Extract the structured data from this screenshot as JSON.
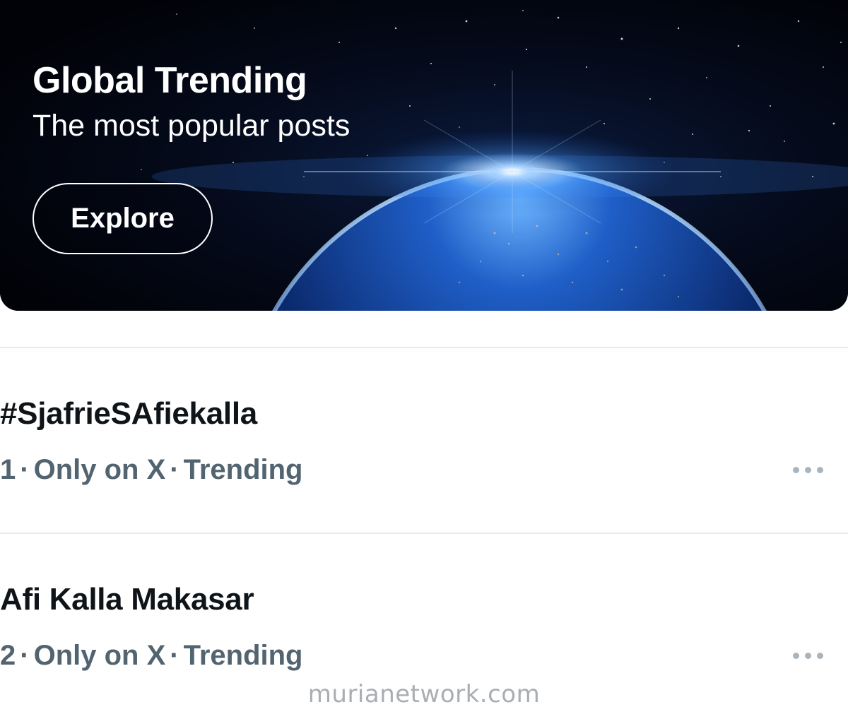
{
  "banner": {
    "title": "Global Trending",
    "subtitle": "The most popular posts",
    "explore_label": "Explore",
    "image": "earth-from-space-sunrise"
  },
  "trends": [
    {
      "rank": "1",
      "name": "#SjafrieSAfiekalla",
      "context": "Only on X",
      "status": "Trending"
    },
    {
      "rank": "2",
      "name": "Afi Kalla Makasar",
      "context": "Only on X",
      "status": "Trending"
    }
  ],
  "separator": "·",
  "more_icon": "more-horizontal-icon",
  "watermark": "murianetwork.com",
  "colors": {
    "text_primary": "#0f1419",
    "text_secondary": "#536471",
    "divider": "#e7e9ea"
  }
}
